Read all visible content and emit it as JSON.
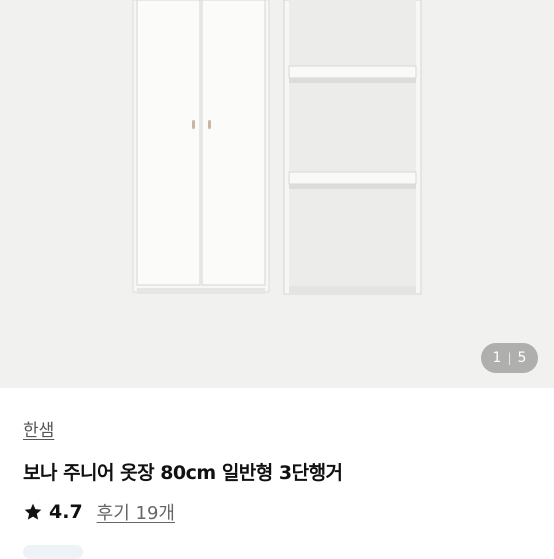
{
  "gallery": {
    "current": "1",
    "total": "5"
  },
  "product": {
    "brand": "한샘",
    "title": "보나 주니어 옷장 80cm 일반형 3단행거",
    "rating": "4.7",
    "reviews_label": "후기 19개"
  },
  "colors": {
    "background": "#f1f1f0",
    "wardrobe": "#f7f7f5"
  },
  "icons": {
    "rating": "star-icon"
  }
}
